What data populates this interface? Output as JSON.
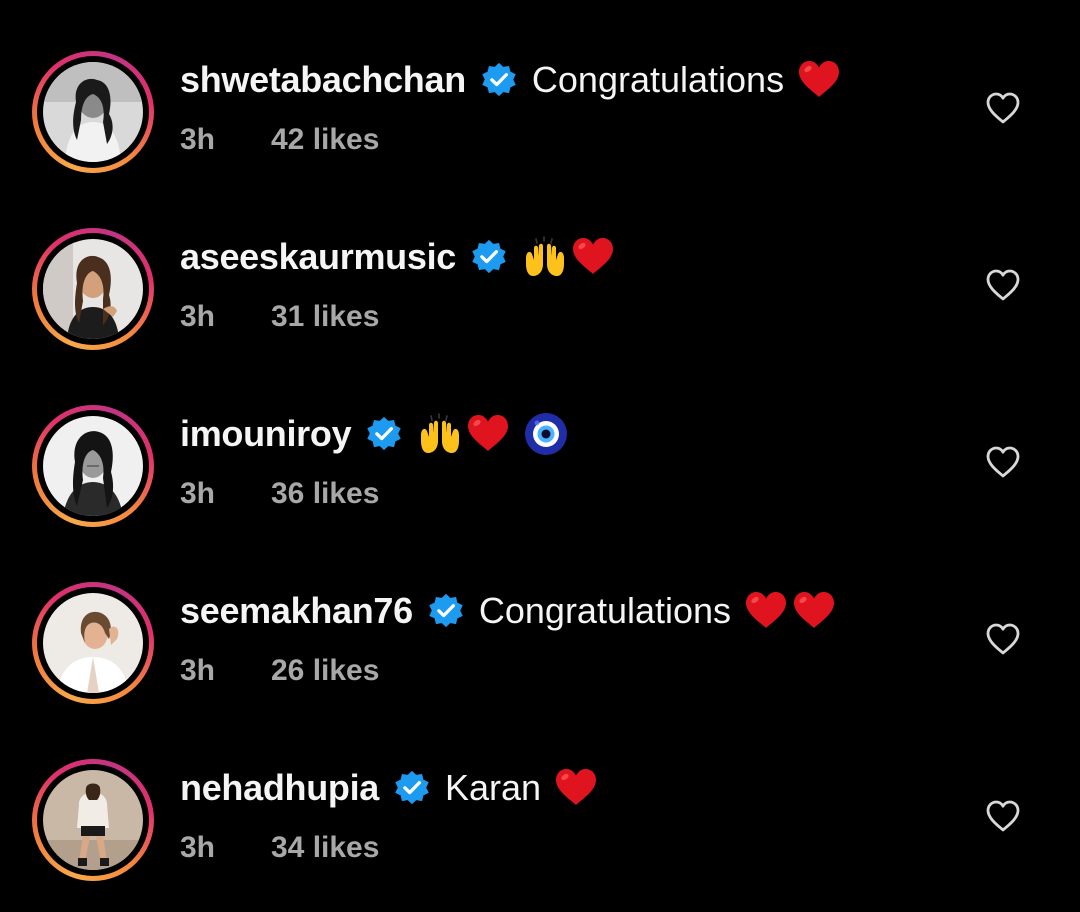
{
  "comments": [
    {
      "username": "shwetabachchan",
      "verified": true,
      "text": "Congratulations",
      "emojis": [
        "red-heart"
      ],
      "time": "3h",
      "likes": "42 likes",
      "avatar_tone": "grayscale"
    },
    {
      "username": "aseeskaurmusic",
      "verified": true,
      "text": "",
      "emojis": [
        "raising-hands",
        "red-heart"
      ],
      "time": "3h",
      "likes": "31 likes",
      "avatar_tone": "color"
    },
    {
      "username": "imouniroy",
      "verified": true,
      "text": "",
      "emojis": [
        "raising-hands",
        "red-heart",
        "nazar-amulet"
      ],
      "time": "3h",
      "likes": "36 likes",
      "avatar_tone": "grayscale"
    },
    {
      "username": "seemakhan76",
      "verified": true,
      "text": "Congratulations",
      "emojis": [
        "red-heart",
        "red-heart"
      ],
      "time": "3h",
      "likes": "26 likes",
      "avatar_tone": "color"
    },
    {
      "username": "nehadhupia",
      "verified": true,
      "text": "Karan",
      "emojis": [
        "red-heart"
      ],
      "time": "3h",
      "likes": "34 likes",
      "avatar_tone": "color"
    }
  ],
  "colors": {
    "background": "#000000",
    "username": "#f5f5f5",
    "meta": "#a8a8a8",
    "verified_badge": "#1d9bf0",
    "heart_emoji": "#e0141e",
    "like_outline": "#d8d8d8"
  },
  "icons": {
    "verified": "verified-badge-icon",
    "like": "heart-outline-icon"
  }
}
